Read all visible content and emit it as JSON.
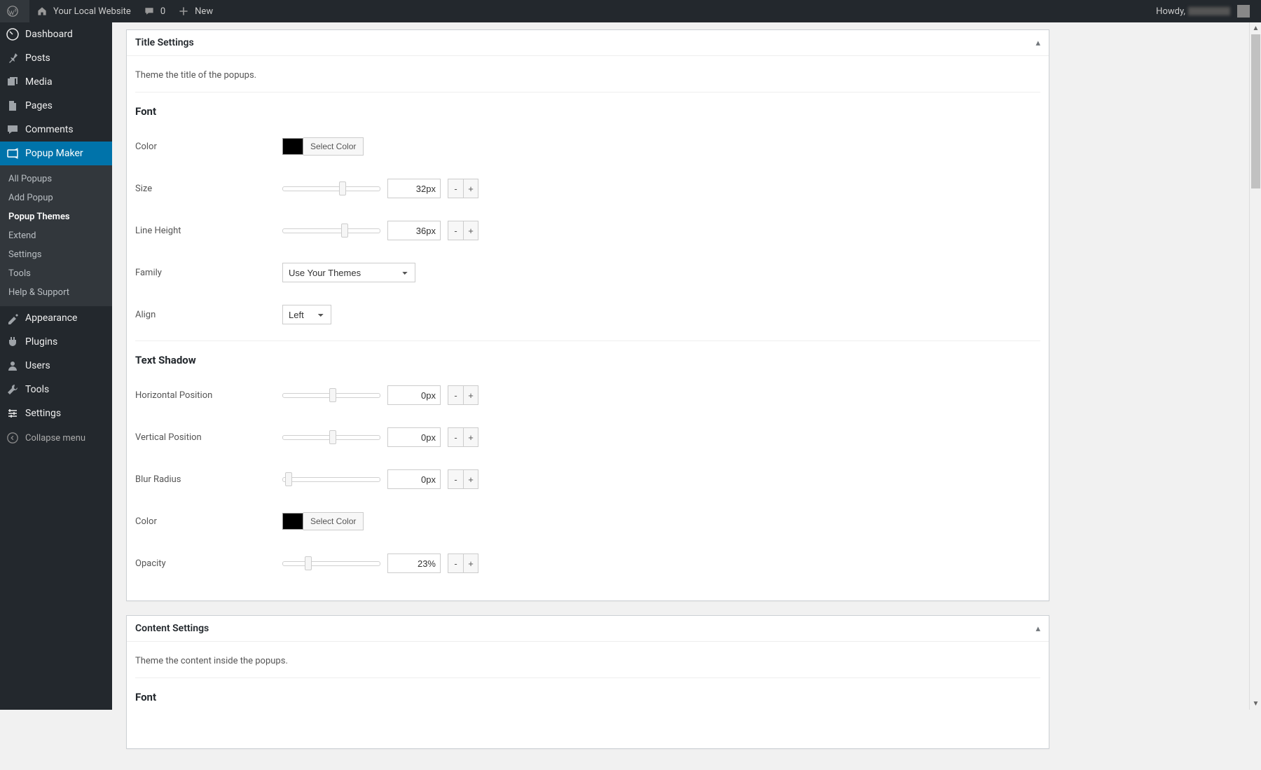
{
  "adminbar": {
    "site_name": "Your Local Website",
    "comments_count": "0",
    "new_label": "New",
    "howdy_prefix": "Howdy,"
  },
  "sidebar": {
    "items": [
      {
        "label": "Dashboard",
        "icon": "dashboard"
      },
      {
        "label": "Posts",
        "icon": "pin"
      },
      {
        "label": "Media",
        "icon": "media"
      },
      {
        "label": "Pages",
        "icon": "pages"
      },
      {
        "label": "Comments",
        "icon": "comment"
      },
      {
        "label": "Popup Maker",
        "icon": "popup",
        "current": true
      },
      {
        "label": "Appearance",
        "icon": "appearance"
      },
      {
        "label": "Plugins",
        "icon": "plugins"
      },
      {
        "label": "Users",
        "icon": "users"
      },
      {
        "label": "Tools",
        "icon": "tools"
      },
      {
        "label": "Settings",
        "icon": "settings"
      }
    ],
    "submenu": [
      {
        "label": "All Popups"
      },
      {
        "label": "Add Popup"
      },
      {
        "label": "Popup Themes",
        "current": true
      },
      {
        "label": "Extend"
      },
      {
        "label": "Settings"
      },
      {
        "label": "Tools"
      },
      {
        "label": "Help & Support"
      }
    ],
    "collapse_label": "Collapse menu"
  },
  "panels": {
    "title_settings": {
      "heading": "Title Settings",
      "desc": "Theme the title of the popups.",
      "font": {
        "section": "Font",
        "color_label": "Color",
        "color_value": "#000000",
        "select_color": "Select Color",
        "size_label": "Size",
        "size_value": "32",
        "size_unit": "px",
        "line_height_label": "Line Height",
        "line_height_value": "36",
        "line_height_unit": "px",
        "family_label": "Family",
        "family_value": "Use Your Themes",
        "align_label": "Align",
        "align_value": "Left"
      },
      "text_shadow": {
        "section": "Text Shadow",
        "hpos_label": "Horizontal Position",
        "hpos_value": "0",
        "hpos_unit": "px",
        "vpos_label": "Vertical Position",
        "vpos_value": "0",
        "vpos_unit": "px",
        "blur_label": "Blur Radius",
        "blur_value": "0",
        "blur_unit": "px",
        "color_label": "Color",
        "color_value": "#000000",
        "select_color": "Select Color",
        "opacity_label": "Opacity",
        "opacity_value": "23",
        "opacity_unit": "%"
      }
    },
    "content_settings": {
      "heading": "Content Settings",
      "desc": "Theme the content inside the popups.",
      "font_section": "Font"
    }
  },
  "ui": {
    "minus": "-",
    "plus": "+"
  }
}
